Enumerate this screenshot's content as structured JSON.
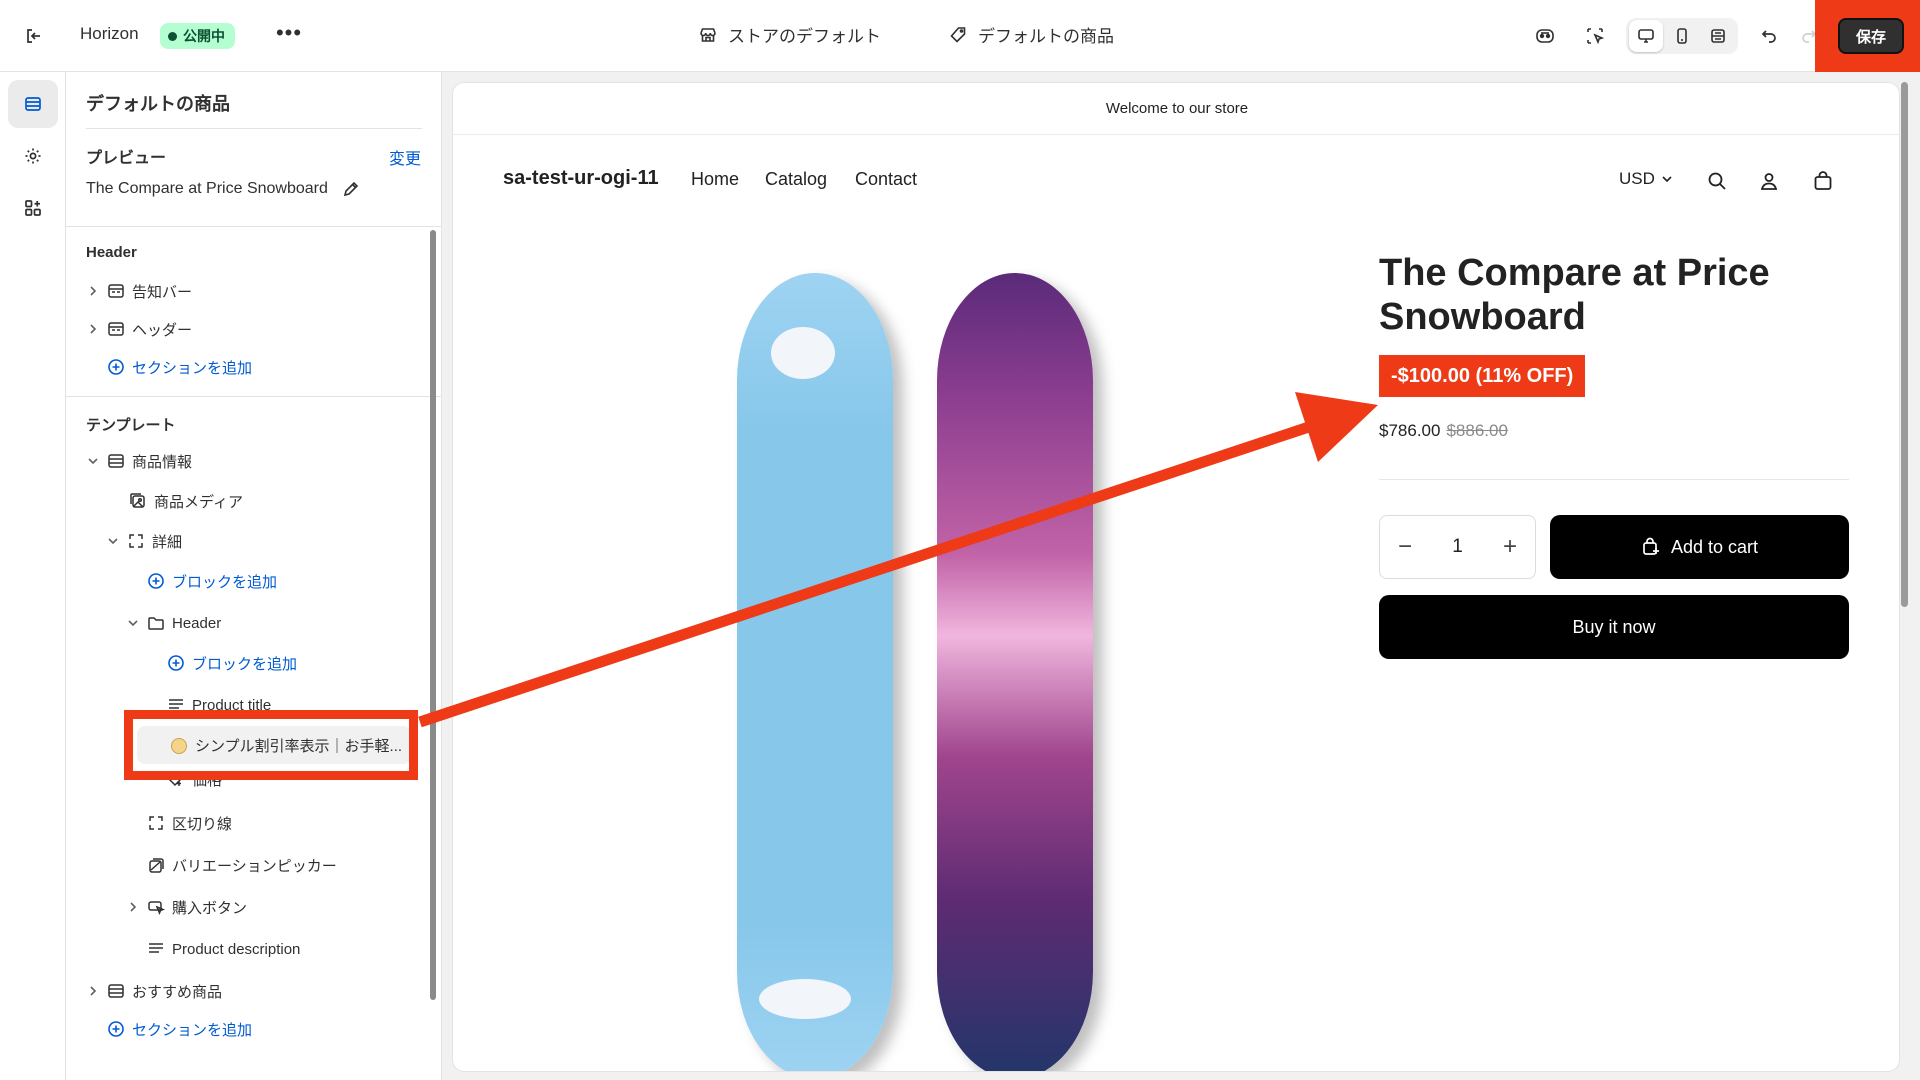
{
  "topbar": {
    "theme_name": "Horizon",
    "status_badge": "公開中",
    "more_label": "•••",
    "store_template": "ストアのデフォルト",
    "product_template": "デフォルトの商品",
    "save_label": "保存"
  },
  "sidebar": {
    "title": "デフォルトの商品",
    "preview_heading": "プレビュー",
    "preview_change": "変更",
    "preview_product": "The Compare at Price Snowboard",
    "header_group": {
      "heading": "Header",
      "items": [
        "告知バー",
        "ヘッダー"
      ],
      "add_section": "セクションを追加"
    },
    "template_group": {
      "heading": "テンプレート",
      "product_info": "商品情報",
      "product_media": "商品メディア",
      "details": "詳細",
      "add_block_1": "ブロックを追加",
      "header_block": "Header",
      "add_block_2": "ブロックを追加",
      "product_title": "Product title",
      "app_block": "シンプル割引率表示｜お手軽...",
      "price": "価格",
      "divider": "区切り線",
      "variant_picker": "バリエーションピッカー",
      "buy_buttons": "購入ボタン",
      "product_description": "Product description",
      "recommended": "おすすめ商品",
      "add_section": "セクションを追加"
    }
  },
  "preview": {
    "announcement": "Welcome to our store",
    "store_name": "sa-test-ur-ogi-11",
    "nav": [
      "Home",
      "Catalog",
      "Contact"
    ],
    "currency": "USD",
    "product_title": "The Compare at Price Snowboard",
    "discount_badge": "-$100.00 (11% OFF)",
    "price": "$786.00",
    "compare_price": "$886.00",
    "quantity": "1",
    "add_to_cart": "Add to cart",
    "buy_now": "Buy it now"
  },
  "colors": {
    "highlight": "#ee3a17",
    "link": "#005bd3",
    "badge_bg": "#b4fed2"
  }
}
